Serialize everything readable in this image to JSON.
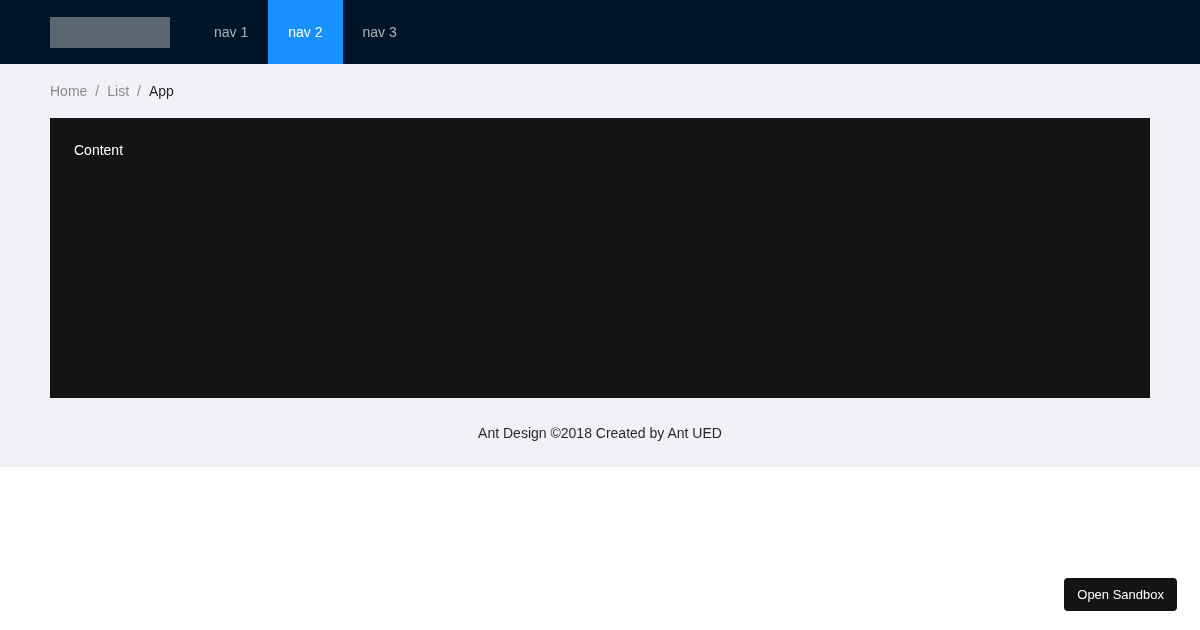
{
  "header": {
    "nav": [
      {
        "label": "nav 1",
        "selected": false
      },
      {
        "label": "nav 2",
        "selected": true
      },
      {
        "label": "nav 3",
        "selected": false
      }
    ]
  },
  "breadcrumb": [
    {
      "label": "Home"
    },
    {
      "separator": "/",
      "label": "List"
    },
    {
      "separator": "/",
      "label": "App"
    }
  ],
  "content": {
    "text": "Content"
  },
  "footer": "Ant Design ©2018 Created by Ant UED",
  "sandbox_button": "Open Sandbox"
}
